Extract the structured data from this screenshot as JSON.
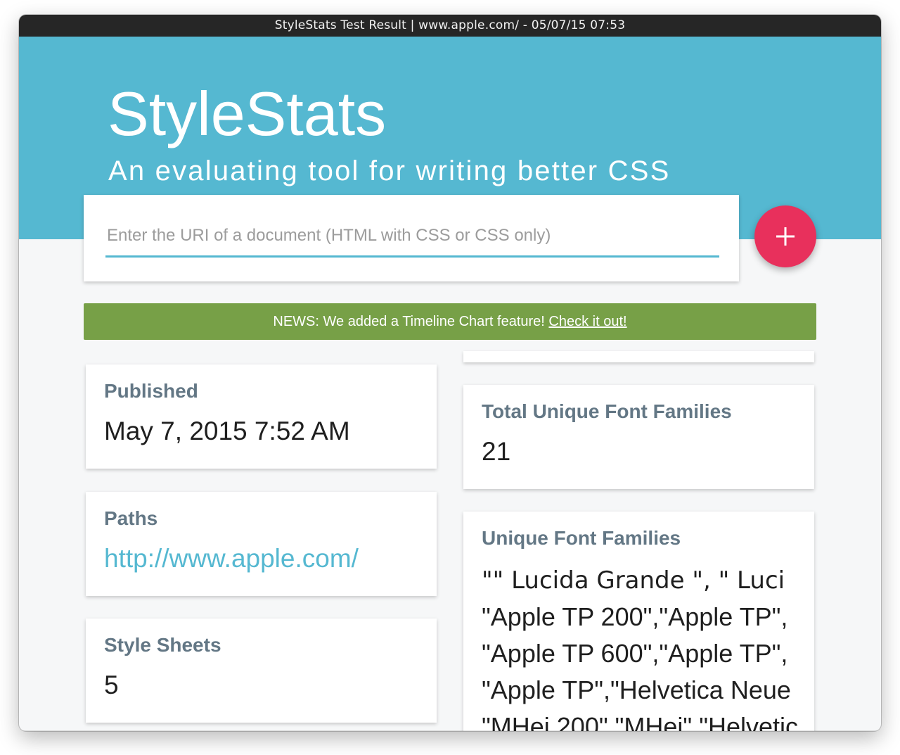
{
  "window": {
    "title": "StyleStats Test Result | www.apple.com/ - 05/07/15 07:53"
  },
  "hero": {
    "title": "StyleStats",
    "subtitle": "An evaluating tool for writing better CSS"
  },
  "search": {
    "placeholder": "Enter the URI of a document (HTML with CSS or CSS only)",
    "value": "",
    "add_button_icon": "plus-icon"
  },
  "news": {
    "text": "NEWS: We added a Timeline Chart feature! ",
    "link": "Check it out!"
  },
  "stats": {
    "published": {
      "label": "Published",
      "value": "May 7, 2015 7:52 AM"
    },
    "paths": {
      "label": "Paths",
      "value": "http://www.apple.com/"
    },
    "style_sheets": {
      "label": "Style Sheets",
      "value": "5"
    },
    "total_unique_font_families": {
      "label": "Total Unique Font Families",
      "value": "21"
    },
    "unique_font_families": {
      "label": "Unique Font Families",
      "values": [
        "\"\" Lucida Grande \", \" Luci",
        "\"Apple TP 200\",\"Apple TP\",",
        "\"Apple TP 600\",\"Apple TP\",",
        "\"Apple TP\",\"Helvetica Neue",
        "\"MHei 200\",\"MHei\",\"Helvetic"
      ]
    }
  },
  "colors": {
    "header": "#55b8d1",
    "accent": "#e8305c",
    "news": "#77a047",
    "label": "#637785"
  }
}
